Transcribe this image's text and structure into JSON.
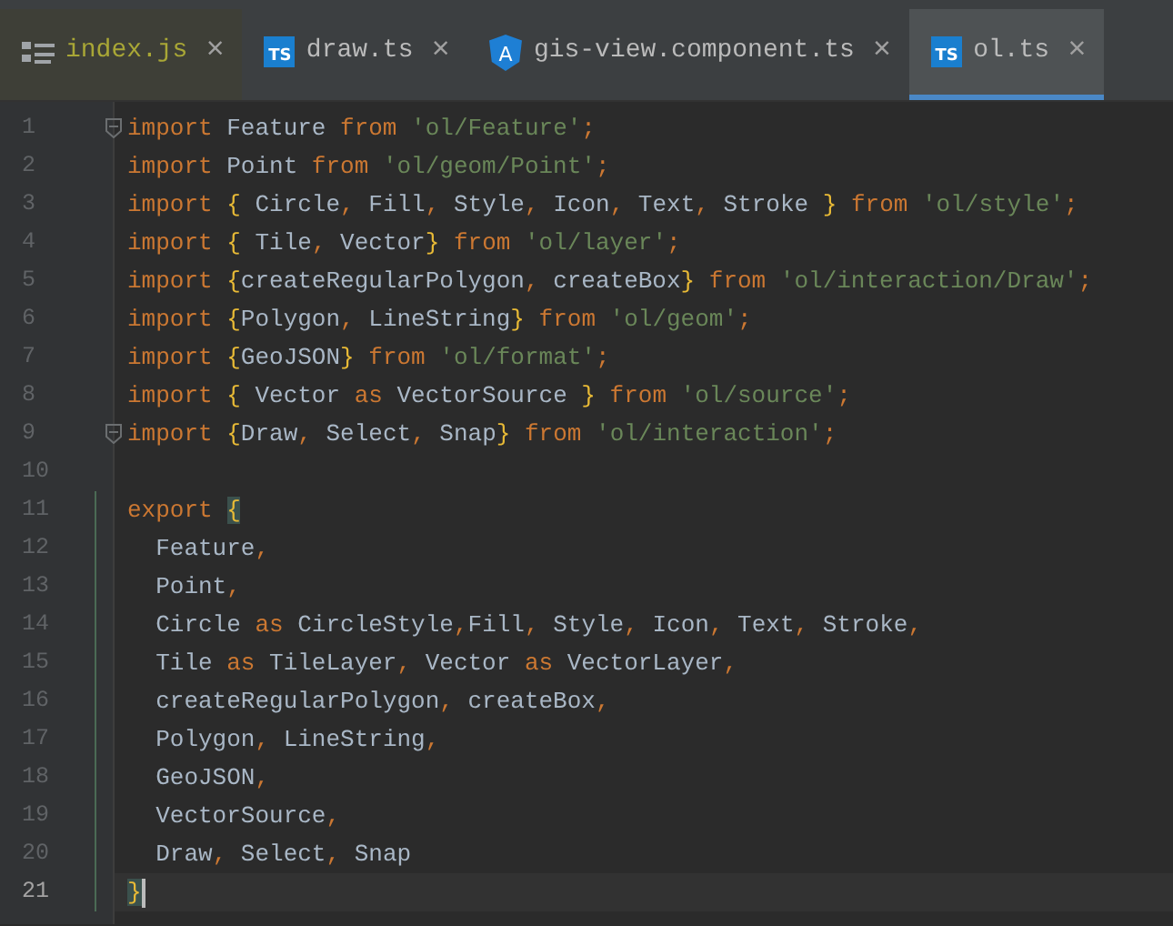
{
  "tabs": [
    {
      "label": "index.js",
      "kind": "js",
      "selected": false
    },
    {
      "label": "draw.ts",
      "kind": "ts",
      "icon_text": "TS",
      "selected": false
    },
    {
      "label": "gis-view.component.ts",
      "kind": "angular",
      "icon_text": "A",
      "selected": false
    },
    {
      "label": "ol.ts",
      "kind": "ts",
      "icon_text": "TS",
      "selected": true
    }
  ],
  "close_glyph": "×",
  "lines": [
    {
      "number": "1",
      "fold": true,
      "current": false,
      "tokens": [
        {
          "kind": "kw",
          "text": "import"
        },
        {
          "kind": "name",
          "text": " Feature "
        },
        {
          "kind": "kw",
          "text": "from"
        },
        {
          "kind": "str",
          "text": " 'ol/Feature'"
        },
        {
          "kind": "punct",
          "text": ";"
        }
      ]
    },
    {
      "number": "2",
      "fold": false,
      "current": false,
      "tokens": [
        {
          "kind": "kw",
          "text": "import"
        },
        {
          "kind": "name",
          "text": " Point "
        },
        {
          "kind": "kw",
          "text": "from"
        },
        {
          "kind": "str",
          "text": " 'ol/geom/Point'"
        },
        {
          "kind": "punct",
          "text": ";"
        }
      ]
    },
    {
      "number": "3",
      "fold": false,
      "current": false,
      "tokens": [
        {
          "kind": "kw",
          "text": "import"
        },
        {
          "kind": "brace",
          "text": " {"
        },
        {
          "kind": "name",
          "text": " Circle"
        },
        {
          "kind": "punct",
          "text": ","
        },
        {
          "kind": "name",
          "text": " Fill"
        },
        {
          "kind": "punct",
          "text": ","
        },
        {
          "kind": "name",
          "text": " Style"
        },
        {
          "kind": "punct",
          "text": ","
        },
        {
          "kind": "name",
          "text": " Icon"
        },
        {
          "kind": "punct",
          "text": ","
        },
        {
          "kind": "name",
          "text": " Text"
        },
        {
          "kind": "punct",
          "text": ","
        },
        {
          "kind": "name",
          "text": " Stroke "
        },
        {
          "kind": "brace",
          "text": "}"
        },
        {
          "kind": "kw",
          "text": " from"
        },
        {
          "kind": "str",
          "text": " 'ol/style'"
        },
        {
          "kind": "punct",
          "text": ";"
        }
      ]
    },
    {
      "number": "4",
      "fold": false,
      "current": false,
      "tokens": [
        {
          "kind": "kw",
          "text": "import"
        },
        {
          "kind": "brace",
          "text": " {"
        },
        {
          "kind": "name",
          "text": " Tile"
        },
        {
          "kind": "punct",
          "text": ","
        },
        {
          "kind": "name",
          "text": " Vector"
        },
        {
          "kind": "brace",
          "text": "}"
        },
        {
          "kind": "kw",
          "text": " from"
        },
        {
          "kind": "str",
          "text": " 'ol/layer'"
        },
        {
          "kind": "punct",
          "text": ";"
        }
      ]
    },
    {
      "number": "5",
      "fold": false,
      "current": false,
      "tokens": [
        {
          "kind": "kw",
          "text": "import"
        },
        {
          "kind": "brace",
          "text": " {"
        },
        {
          "kind": "name",
          "text": "createRegularPolygon"
        },
        {
          "kind": "punct",
          "text": ","
        },
        {
          "kind": "name",
          "text": " createBox"
        },
        {
          "kind": "brace",
          "text": "}"
        },
        {
          "kind": "kw",
          "text": " from"
        },
        {
          "kind": "str",
          "text": " 'ol/interaction/Draw'"
        },
        {
          "kind": "punct",
          "text": ";"
        }
      ]
    },
    {
      "number": "6",
      "fold": false,
      "current": false,
      "tokens": [
        {
          "kind": "kw",
          "text": "import"
        },
        {
          "kind": "brace",
          "text": " {"
        },
        {
          "kind": "name",
          "text": "Polygon"
        },
        {
          "kind": "punct",
          "text": ","
        },
        {
          "kind": "name",
          "text": " LineString"
        },
        {
          "kind": "brace",
          "text": "}"
        },
        {
          "kind": "kw",
          "text": " from"
        },
        {
          "kind": "str",
          "text": " 'ol/geom'"
        },
        {
          "kind": "punct",
          "text": ";"
        }
      ]
    },
    {
      "number": "7",
      "fold": false,
      "current": false,
      "tokens": [
        {
          "kind": "kw",
          "text": "import"
        },
        {
          "kind": "brace",
          "text": " {"
        },
        {
          "kind": "name",
          "text": "GeoJSON"
        },
        {
          "kind": "brace",
          "text": "}"
        },
        {
          "kind": "kw",
          "text": " from"
        },
        {
          "kind": "str",
          "text": " 'ol/format'"
        },
        {
          "kind": "punct",
          "text": ";"
        }
      ]
    },
    {
      "number": "8",
      "fold": false,
      "current": false,
      "tokens": [
        {
          "kind": "kw",
          "text": "import"
        },
        {
          "kind": "brace",
          "text": " {"
        },
        {
          "kind": "name",
          "text": " Vector "
        },
        {
          "kind": "kw",
          "text": "as"
        },
        {
          "kind": "name",
          "text": " VectorSource "
        },
        {
          "kind": "brace",
          "text": "}"
        },
        {
          "kind": "kw",
          "text": " from"
        },
        {
          "kind": "str",
          "text": " 'ol/source'"
        },
        {
          "kind": "punct",
          "text": ";"
        }
      ]
    },
    {
      "number": "9",
      "fold": true,
      "current": false,
      "tokens": [
        {
          "kind": "kw",
          "text": "import"
        },
        {
          "kind": "brace",
          "text": " {"
        },
        {
          "kind": "name",
          "text": "Draw"
        },
        {
          "kind": "punct",
          "text": ","
        },
        {
          "kind": "name",
          "text": " Select"
        },
        {
          "kind": "punct",
          "text": ","
        },
        {
          "kind": "name",
          "text": " Snap"
        },
        {
          "kind": "brace",
          "text": "}"
        },
        {
          "kind": "kw",
          "text": " from"
        },
        {
          "kind": "str",
          "text": " 'ol/interaction'"
        },
        {
          "kind": "punct",
          "text": ";"
        }
      ]
    },
    {
      "number": "10",
      "fold": false,
      "current": false
    },
    {
      "number": "11",
      "fold": false,
      "current": false,
      "tokens": [
        {
          "kind": "kw",
          "text": "export "
        },
        {
          "kind": "match",
          "text": "{"
        }
      ]
    },
    {
      "number": "12",
      "fold": false,
      "current": false,
      "tokens": [
        {
          "kind": "name",
          "text": "  Feature"
        },
        {
          "kind": "punct",
          "text": ","
        }
      ]
    },
    {
      "number": "13",
      "fold": false,
      "current": false,
      "tokens": [
        {
          "kind": "name",
          "text": "  Point"
        },
        {
          "kind": "punct",
          "text": ","
        }
      ]
    },
    {
      "number": "14",
      "fold": false,
      "current": false,
      "tokens": [
        {
          "kind": "name",
          "text": "  Circle "
        },
        {
          "kind": "kw",
          "text": "as"
        },
        {
          "kind": "name",
          "text": " CircleStyle"
        },
        {
          "kind": "punct",
          "text": ","
        },
        {
          "kind": "name",
          "text": "Fill"
        },
        {
          "kind": "punct",
          "text": ","
        },
        {
          "kind": "name",
          "text": " Style"
        },
        {
          "kind": "punct",
          "text": ","
        },
        {
          "kind": "name",
          "text": " Icon"
        },
        {
          "kind": "punct",
          "text": ","
        },
        {
          "kind": "name",
          "text": " Text"
        },
        {
          "kind": "punct",
          "text": ","
        },
        {
          "kind": "name",
          "text": " Stroke"
        },
        {
          "kind": "punct",
          "text": ","
        }
      ]
    },
    {
      "number": "15",
      "fold": false,
      "current": false,
      "tokens": [
        {
          "kind": "name",
          "text": "  Tile "
        },
        {
          "kind": "kw",
          "text": "as"
        },
        {
          "kind": "name",
          "text": " TileLayer"
        },
        {
          "kind": "punct",
          "text": ","
        },
        {
          "kind": "name",
          "text": " Vector "
        },
        {
          "kind": "kw",
          "text": "as"
        },
        {
          "kind": "name",
          "text": " VectorLayer"
        },
        {
          "kind": "punct",
          "text": ","
        }
      ]
    },
    {
      "number": "16",
      "fold": false,
      "current": false,
      "tokens": [
        {
          "kind": "name",
          "text": "  createRegularPolygon"
        },
        {
          "kind": "punct",
          "text": ","
        },
        {
          "kind": "name",
          "text": " createBox"
        },
        {
          "kind": "punct",
          "text": ","
        }
      ]
    },
    {
      "number": "17",
      "fold": false,
      "current": false,
      "tokens": [
        {
          "kind": "name",
          "text": "  Polygon"
        },
        {
          "kind": "punct",
          "text": ","
        },
        {
          "kind": "name",
          "text": " LineString"
        },
        {
          "kind": "punct",
          "text": ","
        }
      ]
    },
    {
      "number": "18",
      "fold": false,
      "current": false,
      "tokens": [
        {
          "kind": "name",
          "text": "  GeoJSON"
        },
        {
          "kind": "punct",
          "text": ","
        }
      ]
    },
    {
      "number": "19",
      "fold": false,
      "current": false,
      "tokens": [
        {
          "kind": "name",
          "text": "  VectorSource"
        },
        {
          "kind": "punct",
          "text": ","
        }
      ]
    },
    {
      "number": "20",
      "fold": false,
      "current": false,
      "tokens": [
        {
          "kind": "name",
          "text": "  Draw"
        },
        {
          "kind": "punct",
          "text": ","
        },
        {
          "kind": "name",
          "text": " Select"
        },
        {
          "kind": "punct",
          "text": ","
        },
        {
          "kind": "name",
          "text": " Snap"
        }
      ]
    },
    {
      "number": "21",
      "fold": false,
      "current": true,
      "tokens": [
        {
          "kind": "match",
          "text": "}"
        }
      ]
    }
  ]
}
